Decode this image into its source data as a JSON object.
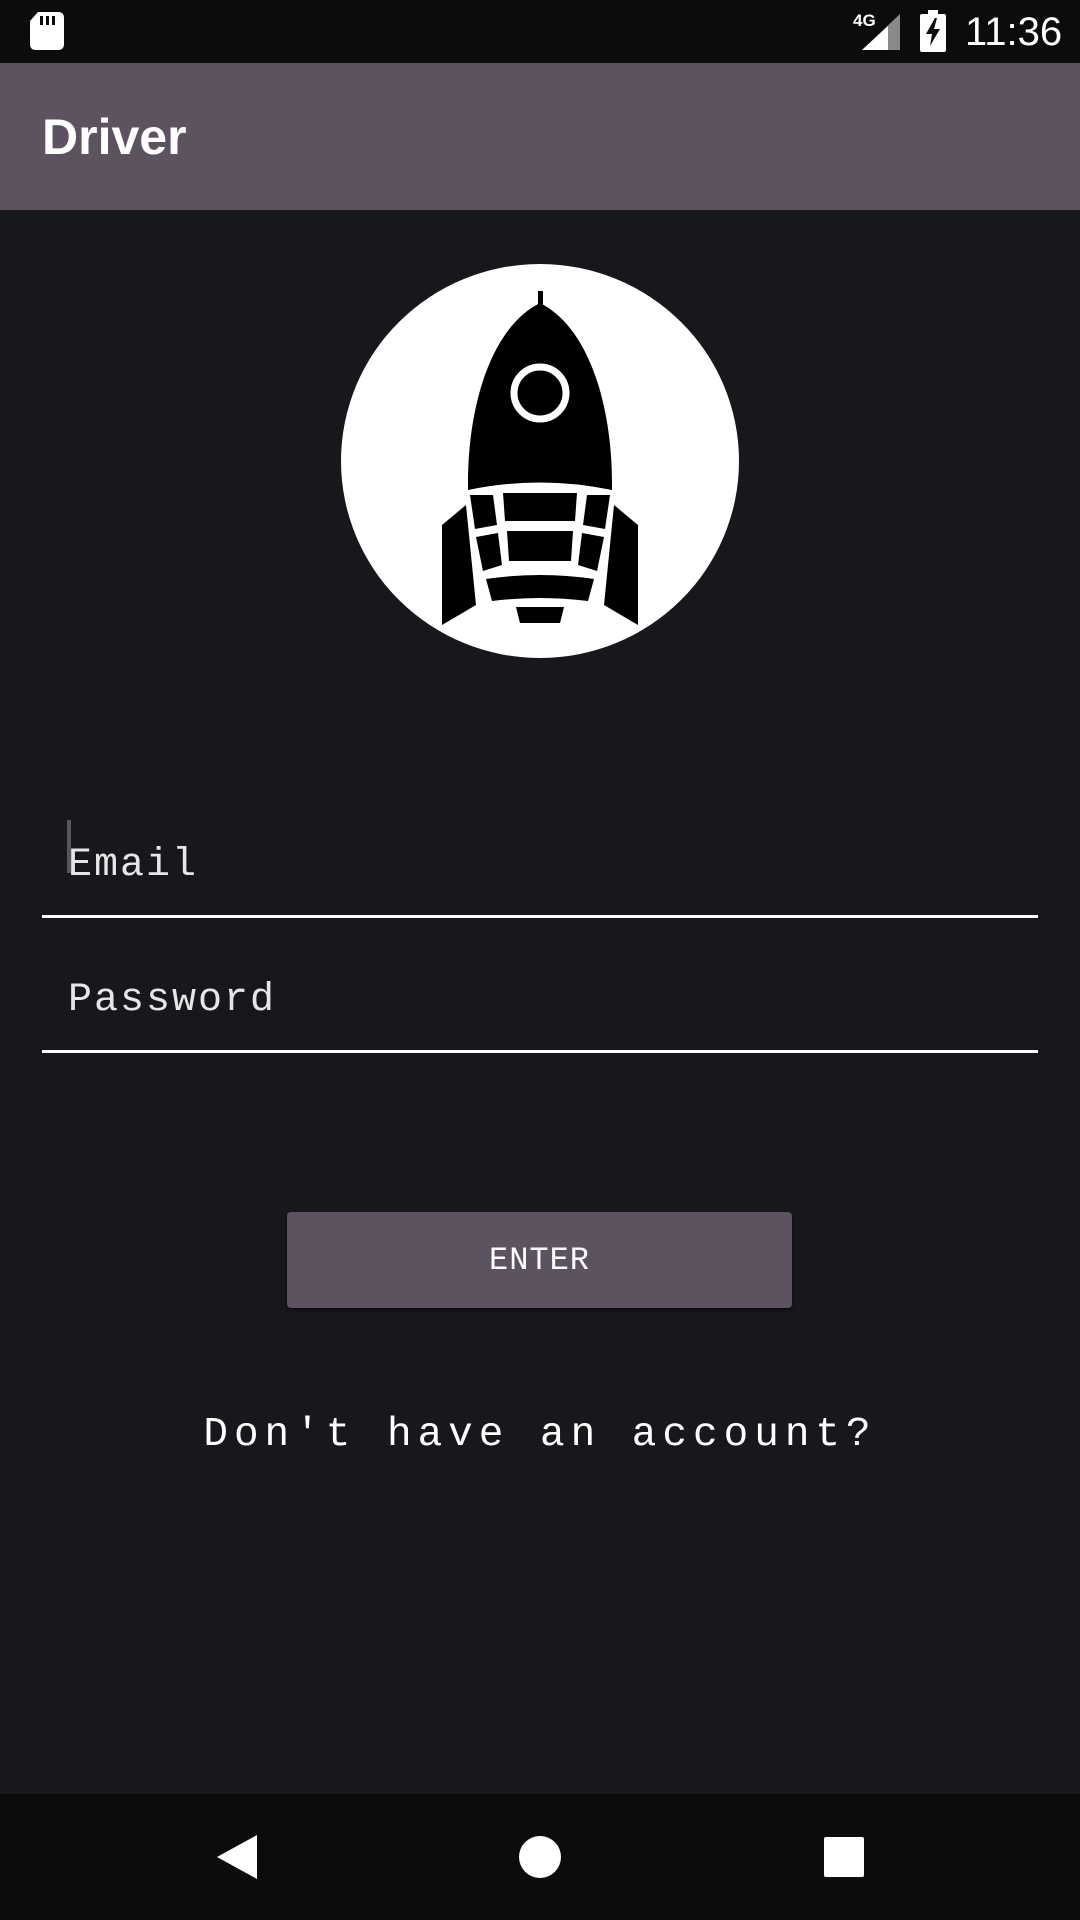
{
  "status_bar": {
    "network": "4G",
    "time": "11:36"
  },
  "app_bar": {
    "title": "Driver"
  },
  "login": {
    "email_placeholder": "Email",
    "password_placeholder": "Password",
    "enter_label": "ENTER",
    "signup_text": "Don't have an account?"
  },
  "icons": {
    "logo": "rocket-icon",
    "nav_back": "back-triangle-icon",
    "nav_home": "home-circle-icon",
    "nav_recents": "recents-square-icon"
  },
  "colors": {
    "accent": "#5d525f",
    "background": "#18171b",
    "bars": "#0c0c0d",
    "text": "#ffffff"
  }
}
